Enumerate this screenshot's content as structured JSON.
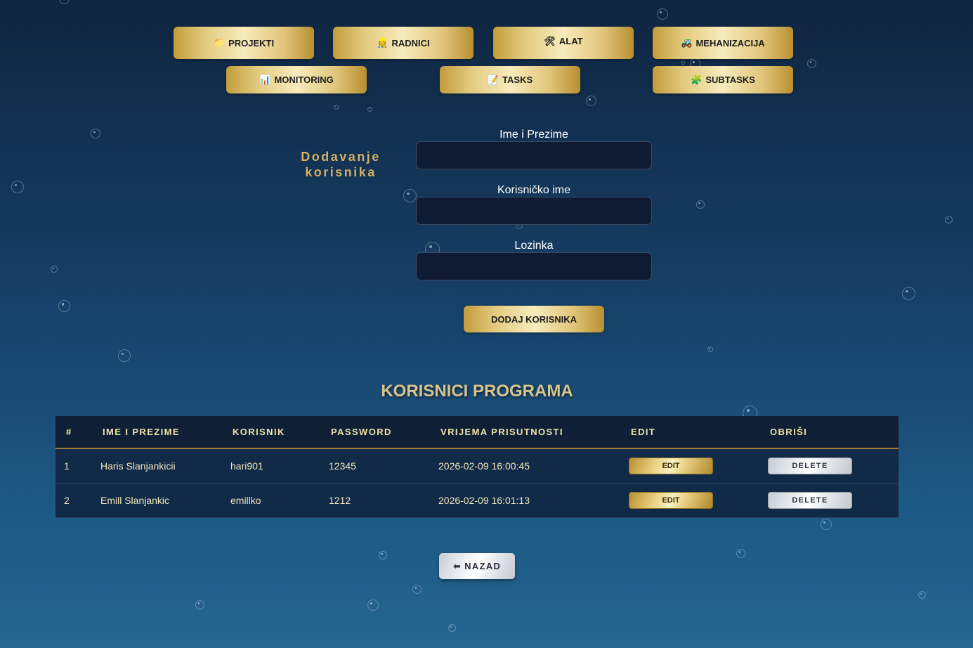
{
  "nav": {
    "projekti": {
      "icon": "📁",
      "label": "PROJEKTI"
    },
    "radnici": {
      "icon": "👷",
      "label": "RADNICI"
    },
    "alat": {
      "icon": "🛠",
      "label": "ALAT"
    },
    "mehanizacija": {
      "icon": "🚜",
      "label": "MEHANIZACIJA"
    },
    "monitoring": {
      "icon": "📊",
      "label": "MONITORING"
    },
    "tasks": {
      "icon": "📝",
      "label": "TASKS"
    },
    "subtasks": {
      "icon": "🧩",
      "label": "SUBTASKS"
    }
  },
  "form": {
    "title": "Dodavanje korisnika",
    "name_label": "Ime i Prezime",
    "name_value": "",
    "username_label": "Korisničko ime",
    "username_value": "",
    "password_label": "Lozinka",
    "password_value": "",
    "submit_label": "DODAJ KORISNIKA"
  },
  "users": {
    "title": "KORISNICI PROGRAMA",
    "headers": {
      "num": "#",
      "name": "IME I PREZIME",
      "user": "KORISNIK",
      "password": "PASSWORD",
      "time": "VRIJEMA PRISUTNOSTI",
      "edit": "EDIT",
      "delete": "OBRIŠI"
    },
    "rows": [
      {
        "num": "1",
        "name": "Haris Slanjankicii",
        "user": "hari901",
        "password": "12345",
        "time": "2026-02-09 16:00:45",
        "edit": "EDIT",
        "delete": "DELETE"
      },
      {
        "num": "2",
        "name": "Emill Slanjankic",
        "user": "emillko",
        "password": "1212",
        "time": "2026-02-09 16:01:13",
        "edit": "EDIT",
        "delete": "DELETE"
      }
    ]
  },
  "back": {
    "icon": "⬅",
    "label": "NAZAD"
  },
  "colors": {
    "gold": "#d4af62",
    "background_top": "#0f2540",
    "background_bottom": "#246690",
    "table_header": "#0f2036",
    "table_row": "#102a47",
    "input_bg": "#0f1b33"
  }
}
